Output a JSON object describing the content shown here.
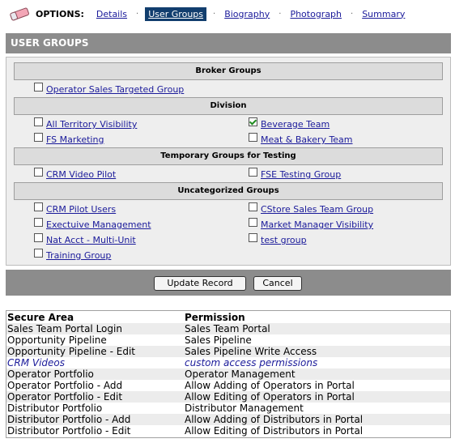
{
  "options": {
    "label": "OPTIONS:",
    "icon": "eraser-icon",
    "tabs": [
      {
        "label": "Details",
        "active": false
      },
      {
        "label": "User Groups",
        "active": true
      },
      {
        "label": "Biography",
        "active": false
      },
      {
        "label": "Photograph",
        "active": false
      },
      {
        "label": "Summary",
        "active": false
      }
    ],
    "separator": "·"
  },
  "section": {
    "title": "USER GROUPS"
  },
  "categories": [
    {
      "name": "Broker Groups"
    },
    {
      "name": "Division"
    },
    {
      "name": "Temporary Groups for Testing"
    },
    {
      "name": "Uncategorized Groups"
    }
  ],
  "groups": {
    "broker": [
      {
        "label": "Operator Sales Targeted Group",
        "checked": false
      }
    ],
    "division": [
      {
        "label": "All Territory Visibility",
        "checked": false
      },
      {
        "label": "Beverage Team",
        "checked": true
      },
      {
        "label": "FS Marketing",
        "checked": false
      },
      {
        "label": "Meat & Bakery Team",
        "checked": false
      }
    ],
    "temporary": [
      {
        "label": "CRM Video Pilot",
        "checked": false
      },
      {
        "label": "FSE Testing Group",
        "checked": false
      }
    ],
    "uncategorized": [
      {
        "label": "CRM Pilot Users",
        "checked": false
      },
      {
        "label": "CStore Sales Team Group",
        "checked": false
      },
      {
        "label": "Exectuive Management",
        "checked": false
      },
      {
        "label": "Market Manager Visibility",
        "checked": false
      },
      {
        "label": "Nat Acct - Multi-Unit",
        "checked": false
      },
      {
        "label": "test group",
        "checked": false
      },
      {
        "label": "Training Group",
        "checked": false
      }
    ]
  },
  "actions": {
    "update": "Update Record",
    "cancel": "Cancel"
  },
  "permissions": {
    "headers": [
      "Secure Area",
      "Permission"
    ],
    "rows": [
      [
        "Sales Team Portal Login",
        "Sales Team Portal"
      ],
      [
        "Opportunity Pipeline",
        "Sales Pipeline"
      ],
      [
        "Opportunity Pipeline - Edit",
        "Sales Pipeline Write Access"
      ],
      [
        "CRM Videos",
        "custom access permissions"
      ],
      [
        "Operator Portfolio",
        "Operator Management"
      ],
      [
        "Operator Portfolio - Add",
        "Allow Adding of Operators in Portal"
      ],
      [
        "Operator Portfolio - Edit",
        "Allow Editing of Operators in Portal"
      ],
      [
        "Distributor Portfolio",
        "Distributor Management"
      ],
      [
        "Distributor Portfolio - Add",
        "Allow Adding of Distributors in Portal"
      ],
      [
        "Distributor Portfolio - Edit",
        "Allow Editing of Distributors in Portal"
      ]
    ]
  },
  "colors": {
    "header_gray": "#8c8c8c",
    "active_tab": "#123e6e",
    "link": "#1a1a9a",
    "check": "#1f8a1f"
  }
}
